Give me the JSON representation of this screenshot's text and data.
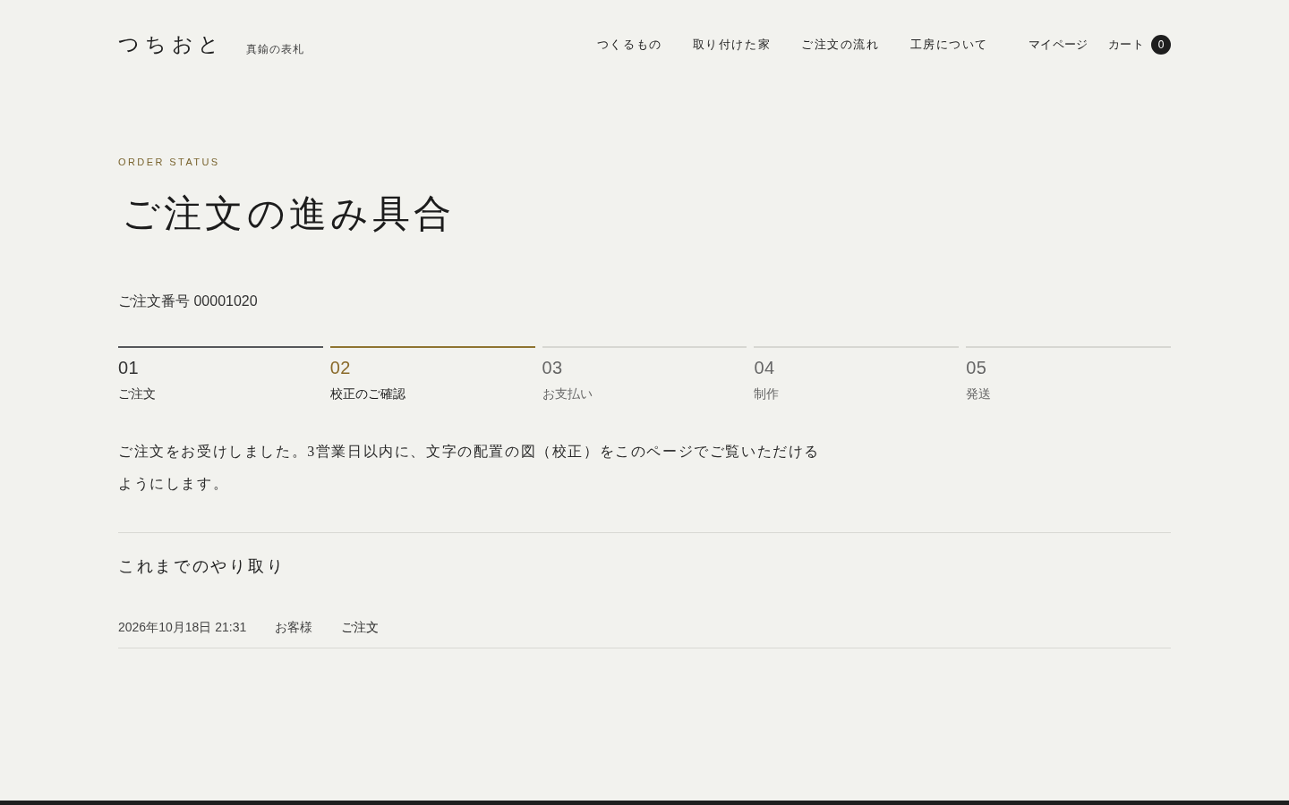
{
  "header": {
    "logo": "つちおと",
    "tagline": "真鍮の表札",
    "nav": [
      "つくるもの",
      "取り付けた家",
      "ご注文の流れ",
      "工房について"
    ],
    "account": "マイページ",
    "cart": {
      "label": "カート",
      "count": "0"
    }
  },
  "page": {
    "eyebrow": "ORDER STATUS",
    "title": "ご注文の進み具合",
    "order_number": "ご注文番号 00001020"
  },
  "steps": [
    {
      "number": "01",
      "label": "ご注文",
      "done": true,
      "selected": false
    },
    {
      "number": "02",
      "label": "校正のご確認",
      "done": false,
      "selected": true
    },
    {
      "number": "03",
      "label": "お支払い",
      "done": false,
      "selected": false
    },
    {
      "number": "04",
      "label": "制作",
      "done": false,
      "selected": false
    },
    {
      "number": "05",
      "label": "発送",
      "done": false,
      "selected": false
    }
  ],
  "message": "ご注文をお受けしました。3営業日以内に、文字の配置の図（校正）をこのページでご覧いただけるようにします。",
  "history": {
    "title": "これまでのやり取り",
    "entries": [
      {
        "datetime": "2026年10月18日 21:31",
        "sender": "お客様",
        "event": "ご注文"
      }
    ]
  }
}
